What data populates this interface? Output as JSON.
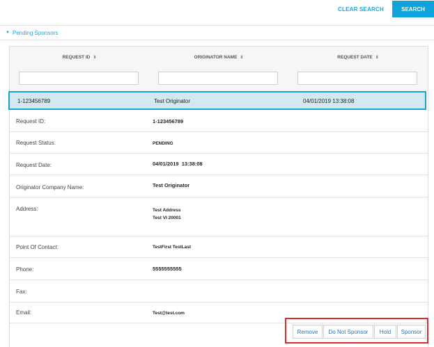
{
  "toolbar": {
    "clear_search_label": "CLEAR SEARCH",
    "search_label": "SEARCH"
  },
  "section": {
    "title": "Pending Sponsors"
  },
  "table": {
    "columns": [
      "REQUEST ID",
      "ORIGINATOR NAME",
      "REQUEST DATE"
    ],
    "selected_row": {
      "request_id": "1-123456789",
      "originator_name": "Test Originator",
      "request_date": "04/01/2019 13:38:08"
    }
  },
  "details": [
    {
      "label": "Request ID:",
      "value": "1-123456789"
    },
    {
      "label": "Request Status:",
      "value": "PENDING"
    },
    {
      "label": "Request Date:",
      "value": "04/01/2019  13:38:08"
    },
    {
      "label": "Originator Company Name:",
      "value": "Test Originator"
    },
    {
      "label": "Address:",
      "value_line1": "Test Address",
      "value_line2": "Test VI 20001"
    },
    {
      "label": "Point Of Contact:",
      "value": "TestFirst TestLast"
    },
    {
      "label": "Phone:",
      "value": "5555555555"
    },
    {
      "label": "Fax:",
      "value": ""
    },
    {
      "label": "Email:",
      "value": "Test@test.com"
    }
  ],
  "actions": {
    "remove": "Remove",
    "do_not_sponsor": "Do Not Sponsor",
    "hold": "Hold",
    "sponsor": "Sponsor"
  },
  "colors": {
    "accent": "#0fa2db",
    "selected_bg": "#d3e8f1",
    "highlight_border": "#e0272b",
    "action_text": "#3070b5"
  }
}
